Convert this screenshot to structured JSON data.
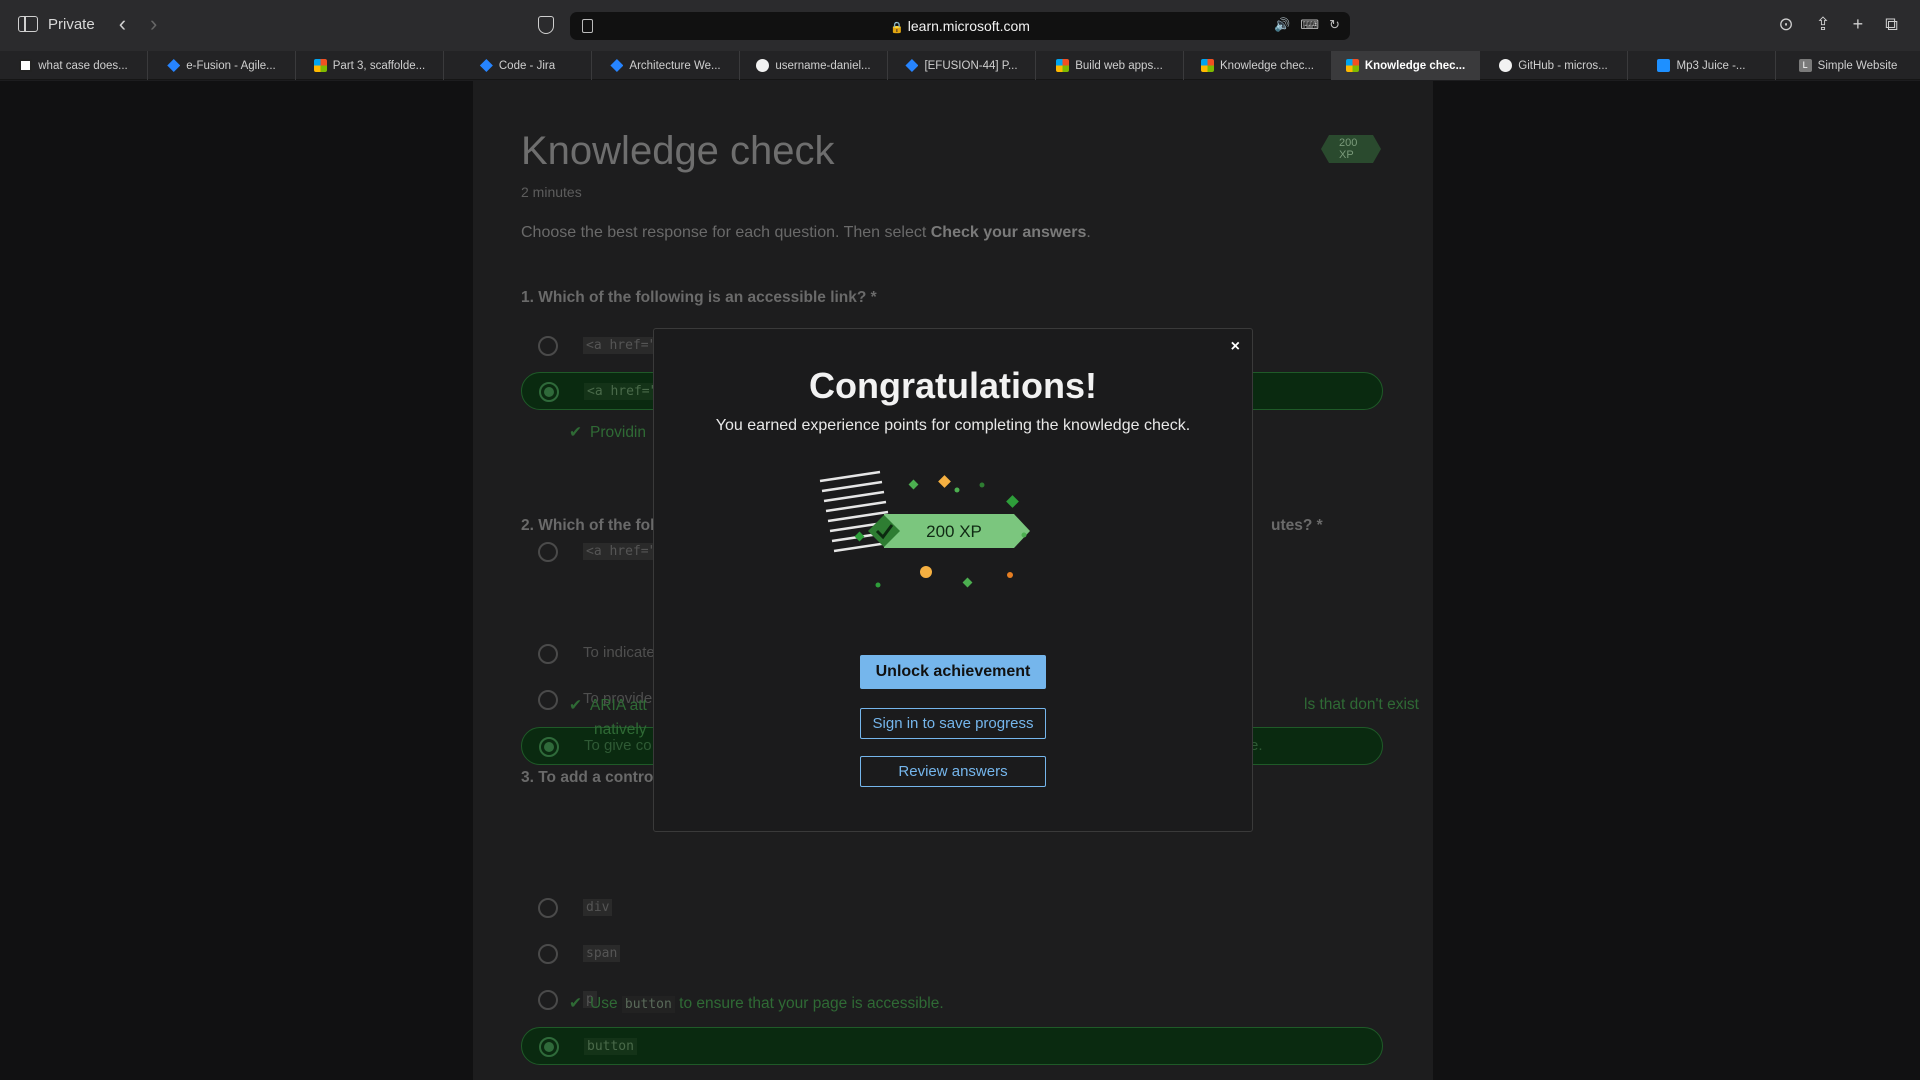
{
  "browser": {
    "private_label": "Private",
    "url": "learn.microsoft.com",
    "tabs": [
      {
        "label": "what case does...",
        "favicon": "p-icon"
      },
      {
        "label": "e-Fusion - Agile...",
        "favicon": "jira-icon"
      },
      {
        "label": "Part 3, scaffolde...",
        "favicon": "ms-icon"
      },
      {
        "label": "Code - Jira",
        "favicon": "jira-icon"
      },
      {
        "label": "Architecture We...",
        "favicon": "jira-icon"
      },
      {
        "label": "username-daniel...",
        "favicon": "github-icon"
      },
      {
        "label": "[EFUSION-44] P...",
        "favicon": "jira-icon"
      },
      {
        "label": "Build web apps...",
        "favicon": "ms-icon"
      },
      {
        "label": "Knowledge chec...",
        "favicon": "ms-icon"
      },
      {
        "label": "Knowledge chec...",
        "favicon": "ms-icon",
        "active": true
      },
      {
        "label": "GitHub - micros...",
        "favicon": "github-icon"
      },
      {
        "label": "Mp3 Juice -...",
        "favicon": "download-icon"
      },
      {
        "label": "Simple Website",
        "favicon": "l-icon",
        "favicon_letter": "L"
      }
    ]
  },
  "page": {
    "title": "Knowledge check",
    "duration": "2 minutes",
    "xp_badge": "200 XP",
    "instructions_prefix": "Choose the best response for each question. Then select ",
    "instructions_bold": "Check your answers",
    "instructions_suffix": ".",
    "q1": {
      "text": "1. Which of the following is an accessible link? *",
      "options": [
        "<a href=\"",
        "<a href=\"",
        "<a href=\""
      ],
      "feedback": "Providin"
    },
    "q2": {
      "text_left": "2. Which of the fol",
      "text_right": "utes? *",
      "options": [
        "To indicate",
        "To provide",
        "To give co"
      ],
      "option3_right": "e.",
      "feedback_line1_left": "ARIA att",
      "feedback_line1_right": "ls that don't exist",
      "feedback_line2": "natively"
    },
    "q3": {
      "text_left": "3. To add a contro",
      "options": [
        "div",
        "span",
        "p",
        "button"
      ],
      "feedback_prefix": "Use ",
      "feedback_code": "button",
      "feedback_suffix": " to ensure that your page is accessible."
    }
  },
  "modal": {
    "close_label": "×",
    "title": "Congratulations!",
    "subtitle": "You earned experience points for completing the knowledge check.",
    "xp_label": "200 XP",
    "unlock_button": "Unlock achievement",
    "signin_button": "Sign in to save progress",
    "review_button": "Review answers"
  },
  "colors": {
    "accent_blue": "#75b6ec",
    "correct_green": "#2f6a35",
    "xp_green": "#7bc67e"
  }
}
